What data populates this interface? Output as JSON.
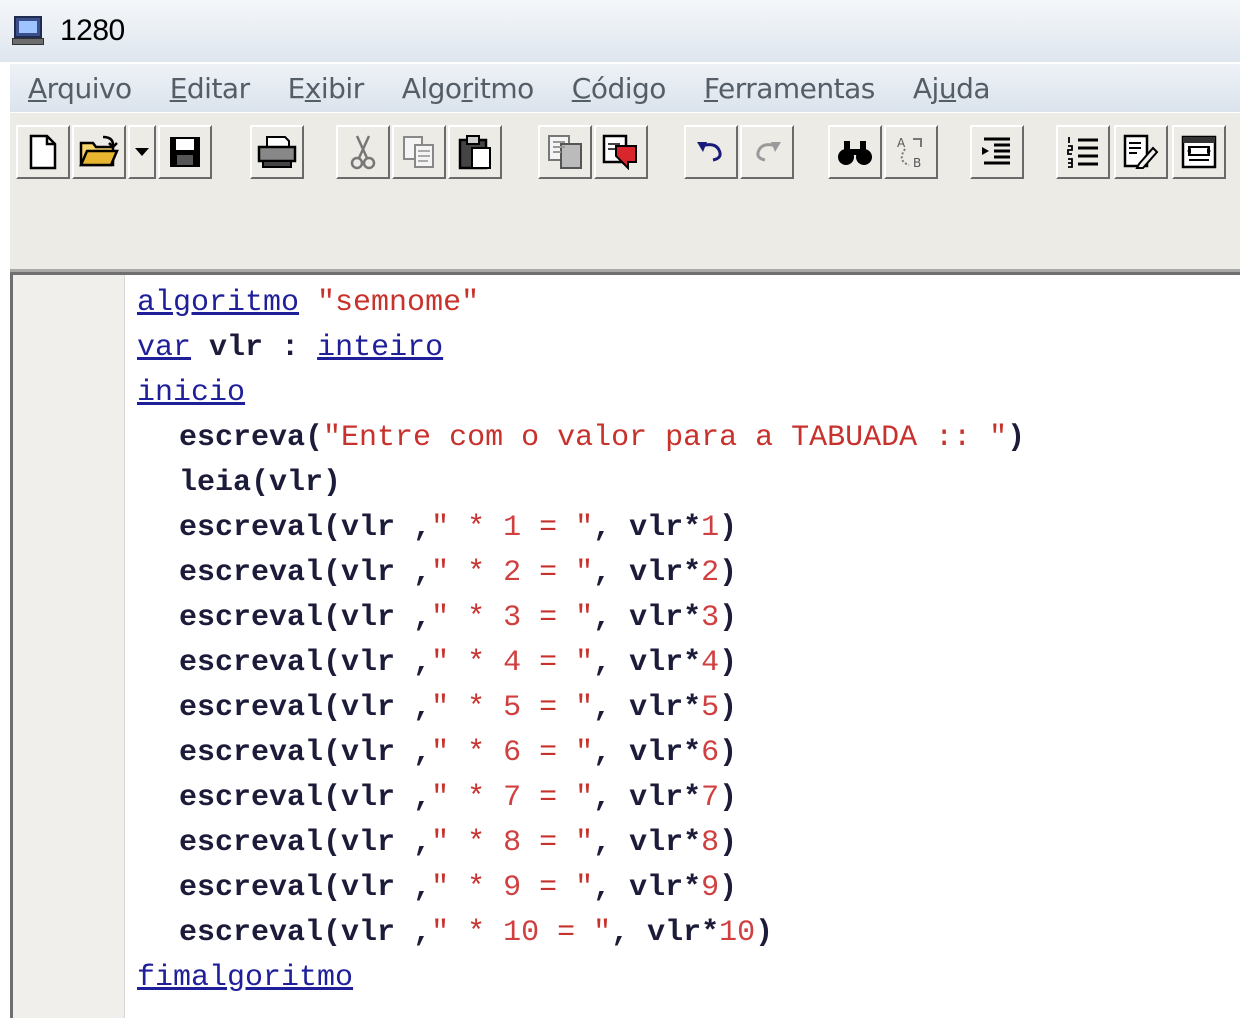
{
  "window": {
    "title": "1280"
  },
  "menu": {
    "items": [
      {
        "pre": "",
        "u": "A",
        "post": "rquivo"
      },
      {
        "pre": "",
        "u": "E",
        "post": "ditar"
      },
      {
        "pre": "E",
        "u": "x",
        "post": "ibir"
      },
      {
        "pre": "Algo",
        "u": "r",
        "post": "itmo"
      },
      {
        "pre": "",
        "u": "C",
        "post": "ódigo"
      },
      {
        "pre": "",
        "u": "F",
        "post": "erramentas"
      },
      {
        "pre": "Aj",
        "u": "u",
        "post": "da"
      }
    ]
  },
  "toolbar": {
    "buttons": [
      "new-file-icon",
      "open-folder-icon",
      "dropdown-arrow-icon",
      "save-icon",
      "print-icon",
      "cut-icon",
      "copy-icon",
      "paste-icon",
      "copy-document-icon",
      "paste-document-icon",
      "undo-icon",
      "redo-icon",
      "find-icon",
      "replace-icon",
      "indent-icon",
      "numbered-list-icon",
      "document-edit-icon",
      "form-icon"
    ]
  },
  "code": {
    "header": {
      "kw": "algoritmo",
      "name": "\"semnome\""
    },
    "var_line": {
      "kw": "var",
      "ident": "vlr",
      "sep": ":",
      "type": "inteiro"
    },
    "begin_kw": "inicio",
    "prompt": {
      "fn": "escreva",
      "str": "\"Entre com o valor para a TABUADA :: \""
    },
    "read": {
      "fn": "leia",
      "arg": "vlr"
    },
    "table_rows": [
      {
        "fn": "escreval",
        "arg": "vlr",
        "str_a": "\" * ",
        "n": "1",
        "str_b": " = \"",
        "expr": "vlr*",
        "m": "1"
      },
      {
        "fn": "escreval",
        "arg": "vlr",
        "str_a": "\" * ",
        "n": "2",
        "str_b": " = \"",
        "expr": "vlr*",
        "m": "2"
      },
      {
        "fn": "escreval",
        "arg": "vlr",
        "str_a": "\" * ",
        "n": "3",
        "str_b": " = \"",
        "expr": "vlr*",
        "m": "3"
      },
      {
        "fn": "escreval",
        "arg": "vlr",
        "str_a": "\" * ",
        "n": "4",
        "str_b": " = \"",
        "expr": "vlr*",
        "m": "4"
      },
      {
        "fn": "escreval",
        "arg": "vlr",
        "str_a": "\" * ",
        "n": "5",
        "str_b": " = \"",
        "expr": "vlr*",
        "m": "5"
      },
      {
        "fn": "escreval",
        "arg": "vlr",
        "str_a": "\" * ",
        "n": "6",
        "str_b": " = \"",
        "expr": "vlr*",
        "m": "6"
      },
      {
        "fn": "escreval",
        "arg": "vlr",
        "str_a": "\" * ",
        "n": "7",
        "str_b": " = \"",
        "expr": "vlr*",
        "m": "7"
      },
      {
        "fn": "escreval",
        "arg": "vlr",
        "str_a": "\" * ",
        "n": "8",
        "str_b": " = \"",
        "expr": "vlr*",
        "m": "8"
      },
      {
        "fn": "escreval",
        "arg": "vlr",
        "str_a": "\" * ",
        "n": "9",
        "str_b": " = \"",
        "expr": "vlr*",
        "m": "9"
      },
      {
        "fn": "escreval",
        "arg": "vlr",
        "str_a": "\" * ",
        "n": "10",
        "str_b": " = \"",
        "expr": "vlr*",
        "m": "10"
      }
    ],
    "end_kw": "fimalgoritmo"
  },
  "colors": {
    "keyword": "#1f1f9a",
    "string": "#c8322d",
    "number": "#d04040",
    "identifier": "#1c1c3a"
  }
}
